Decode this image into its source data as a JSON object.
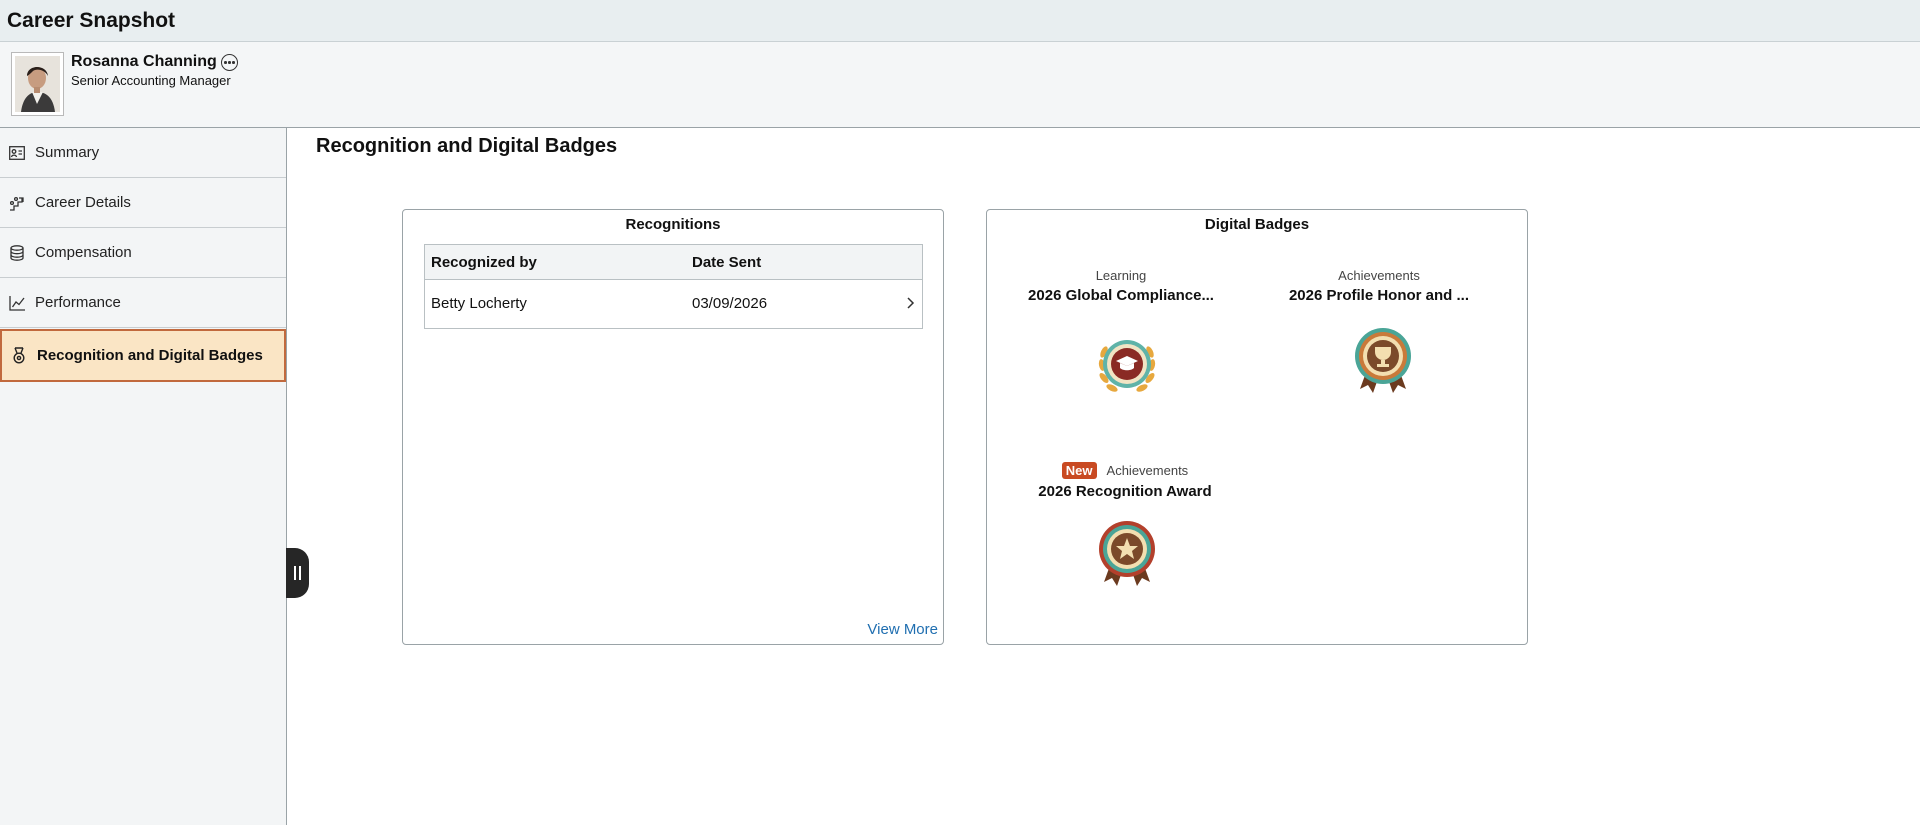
{
  "app": {
    "title": "Career Snapshot"
  },
  "person": {
    "name": "Rosanna Channing",
    "job_title": "Senior Accounting Manager"
  },
  "nav": {
    "items": [
      {
        "label": "Summary",
        "icon": "id-card-icon"
      },
      {
        "label": "Career Details",
        "icon": "career-steps-icon"
      },
      {
        "label": "Compensation",
        "icon": "coins-stack-icon"
      },
      {
        "label": "Performance",
        "icon": "line-chart-icon"
      },
      {
        "label": "Recognition and Digital Badges",
        "icon": "medal-icon",
        "active": true
      }
    ]
  },
  "page": {
    "heading": "Recognition and Digital Badges"
  },
  "recognitions": {
    "title": "Recognitions",
    "columns": [
      "Recognized by",
      "Date Sent"
    ],
    "rows": [
      {
        "recognized_by": "Betty Locherty",
        "date_sent": "03/09/2026"
      }
    ],
    "view_more": "View More"
  },
  "badges": {
    "title": "Digital Badges",
    "items": [
      {
        "category": "Learning",
        "name": "2026 Global Compliance...",
        "icon": "graduation-cap-medal-icon"
      },
      {
        "category": "Achievements",
        "name": "2026 Profile Honor and ...",
        "icon": "trophy-medal-icon"
      },
      {
        "category": "Achievements",
        "name": "2026 Recognition Award",
        "icon": "star-medal-icon",
        "new_label": "New"
      }
    ]
  },
  "colors": {
    "accent": "#c1693d",
    "active_bg": "#fae5c5",
    "link": "#1f6eb0",
    "new_badge": "#c94a22"
  }
}
